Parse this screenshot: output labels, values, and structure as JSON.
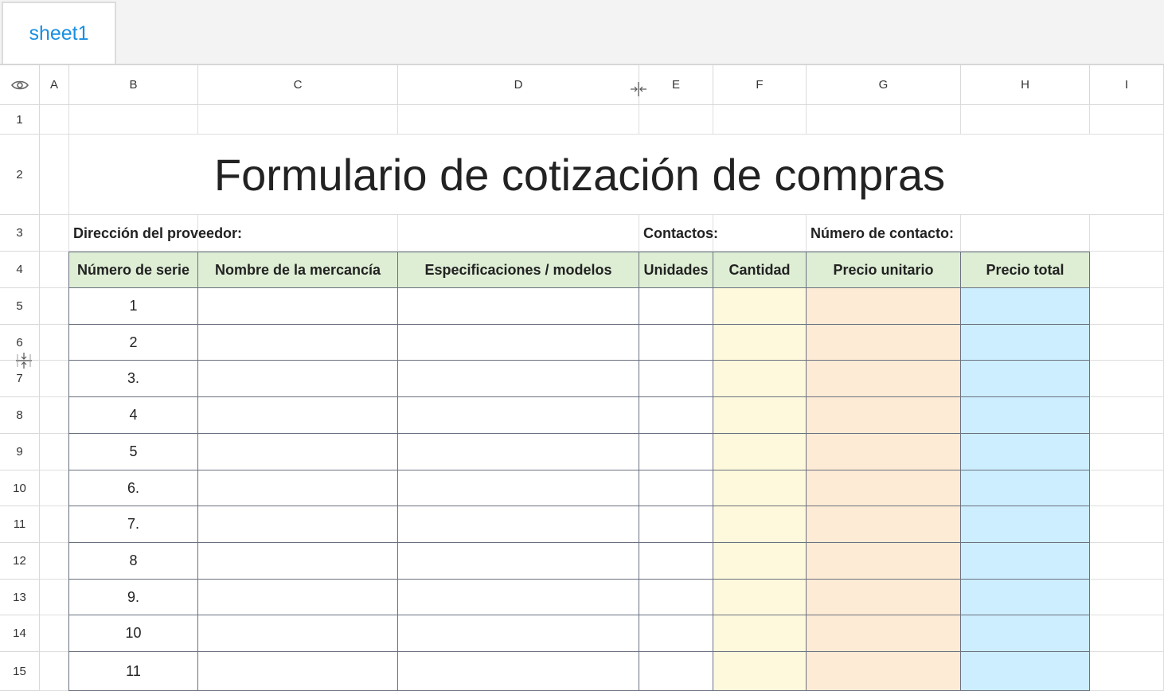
{
  "sheet_tabs": [
    {
      "label": "sheet1"
    }
  ],
  "columns": [
    "A",
    "B",
    "C",
    "D",
    "E",
    "F",
    "G",
    "H",
    "I"
  ],
  "rows": [
    "1",
    "2",
    "3",
    "4",
    "5",
    "6",
    "7",
    "8",
    "9",
    "10",
    "11",
    "12",
    "13",
    "14",
    "15"
  ],
  "title": "Formulario de cotización de compras",
  "info_labels": {
    "supplier_address": "Dirección del proveedor:",
    "contacts": "Contactos:",
    "contact_number": "Número de contacto:"
  },
  "table_headers": [
    "Número de serie",
    "Nombre de la mercancía",
    "Especificaciones / modelos",
    "Unidades",
    "Cantidad",
    "Precio unitario",
    "Precio total"
  ],
  "serial_numbers": [
    "1",
    "2",
    "3.",
    "4",
    "5",
    "6.",
    "7.",
    "8",
    "9.",
    "10",
    "11"
  ],
  "fill_colors": {
    "header": "#deeed5",
    "cantidad": "#fef9dc",
    "precio_unitario": "#fdebd5",
    "precio_total": "#cdeefe"
  },
  "icons": {
    "visibility": "eye-icon",
    "col_resize": "column-resize-icon",
    "row_resize": "row-resize-icon"
  }
}
